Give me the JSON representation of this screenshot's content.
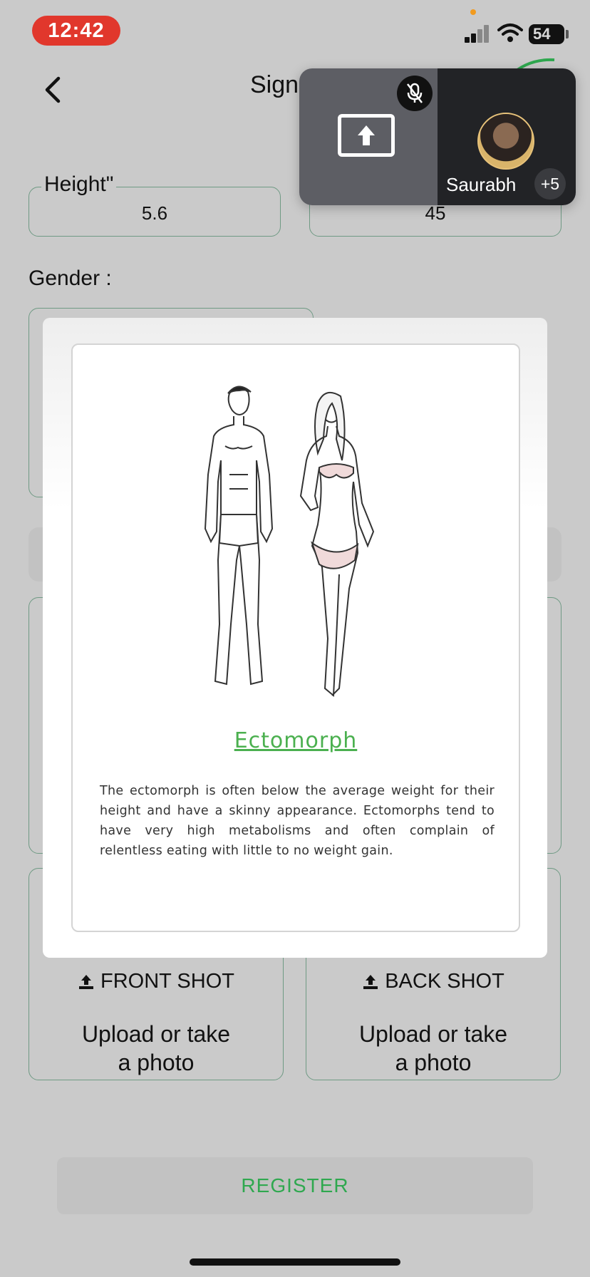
{
  "status_bar": {
    "time": "12:42",
    "battery": "54"
  },
  "nav": {
    "title": "Sign"
  },
  "call": {
    "participant": "Saurabh",
    "extra_count": "+5"
  },
  "form": {
    "height_label": "Height\"",
    "height_value": "5.6",
    "weight_value": "45",
    "gender_label": "Gender :"
  },
  "uploads": {
    "front_title": "FRONT SHOT",
    "back_title": "BACK SHOT",
    "subtitle_line1": "Upload or take",
    "subtitle_line2": "a photo"
  },
  "register_label": "REGISTER",
  "modal": {
    "title": "Ectomorph",
    "description": "The ectomorph is often below the average weight for their height and have a skinny appearance. Ectomorphs  tend to have very high metabolisms and often complain of relentless eating with little to no weight gain."
  },
  "colors": {
    "accent_green": "#2fa84f",
    "status_red": "#e1372c",
    "field_border": "#6f9a84"
  }
}
